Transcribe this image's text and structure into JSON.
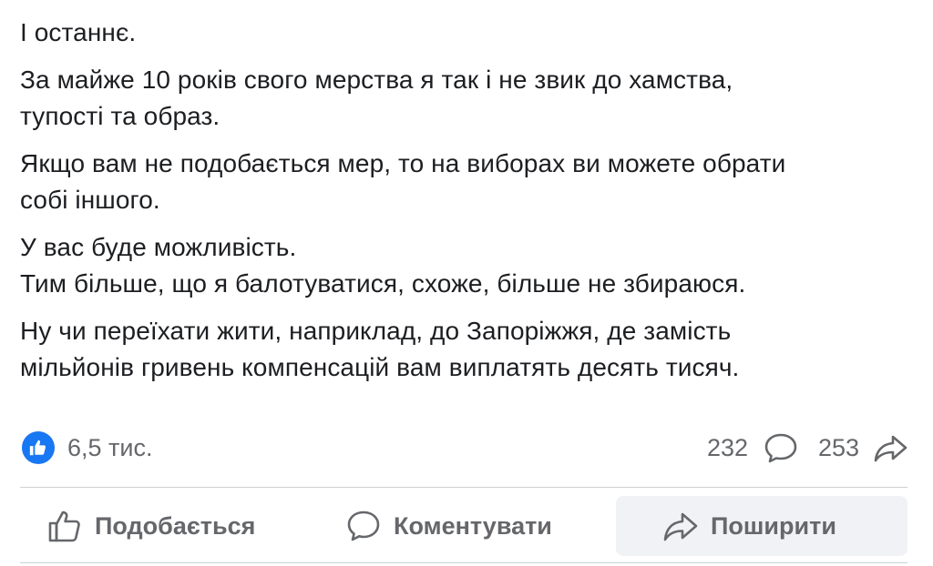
{
  "post": {
    "paragraphs": [
      [
        "І останнє."
      ],
      [
        "За майже 10 років свого мерства я так і не звик до хамства,",
        "тупості та образ."
      ],
      [
        "Якщо вам не подобається мер, то на виборах ви можете обрати",
        "собі іншого."
      ],
      [
        "У вас буде можливість.",
        "Тим більше, що я балотуватися, схоже,  більше не збираюся."
      ],
      [
        "Ну чи переїхати жити, наприклад, до Запоріжжя, де замість",
        "мільйонів гривень компенсацій вам виплатять десять тисяч."
      ]
    ]
  },
  "reactions": {
    "icon": "thumbs-up-badge-icon",
    "count": "6,5 тис.",
    "comments_count": "232",
    "comments_icon": "speech-bubble-icon",
    "shares_count": "253",
    "shares_icon": "share-arrow-icon"
  },
  "actions": {
    "like_label": "Подобається",
    "comment_label": "Коментувати",
    "share_label": "Поширити"
  },
  "colors": {
    "accent": "#1877f2",
    "secondary_text": "#65676b",
    "primary_text": "#1c1e21",
    "share_bg": "#f0f2f5"
  }
}
